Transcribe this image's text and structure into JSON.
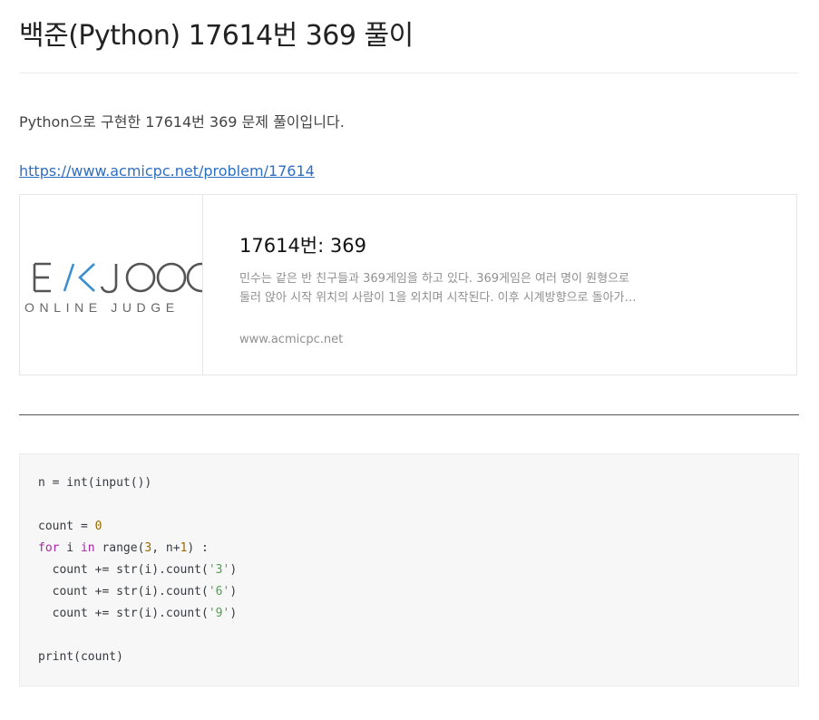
{
  "post": {
    "title": "백준(Python) 17614번 369 풀이",
    "intro": "Python으로 구현한 17614번 369 문제 풀이입니다.",
    "link_text": "https://www.acmicpc.net/problem/17614"
  },
  "og_card": {
    "logo_text_top": "EKJOO",
    "logo_text_bottom": "ONLINE JUDGE",
    "title": "17614번: 369",
    "desc_line1": "민수는 같은 반 친구들과 369게임을 하고 있다. 369게임은 여러 명이 원형으로",
    "desc_line2": "둘러 앉아 시작 위치의 사람이 1을 외치며 시작된다. 이후 시계방향으로 돌아가…",
    "host": "www.acmicpc.net"
  },
  "code": {
    "line1": {
      "a": "n = int(input())"
    },
    "line3": {
      "a": "count = ",
      "b": "0"
    },
    "line4": {
      "kw1": "for",
      "a": " i ",
      "kw2": "in",
      "b": " range(",
      "n1": "3",
      "c": ", n+",
      "n2": "1",
      "d": ") :"
    },
    "line5": {
      "a": "  count += str(i).count(",
      "s": "'3'",
      "b": ")"
    },
    "line6": {
      "a": "  count += str(i).count(",
      "s": "'6'",
      "b": ")"
    },
    "line7": {
      "a": "  count += str(i).count(",
      "s": "'9'",
      "b": ")"
    },
    "line9": {
      "a": "print(count)"
    }
  },
  "colors": {
    "link": "#2f6fbf",
    "logo_accent": "#3a8fd0",
    "logo_gray": "#555555",
    "keyword": "#a626a4",
    "number": "#986801",
    "string": "#50a14f"
  }
}
